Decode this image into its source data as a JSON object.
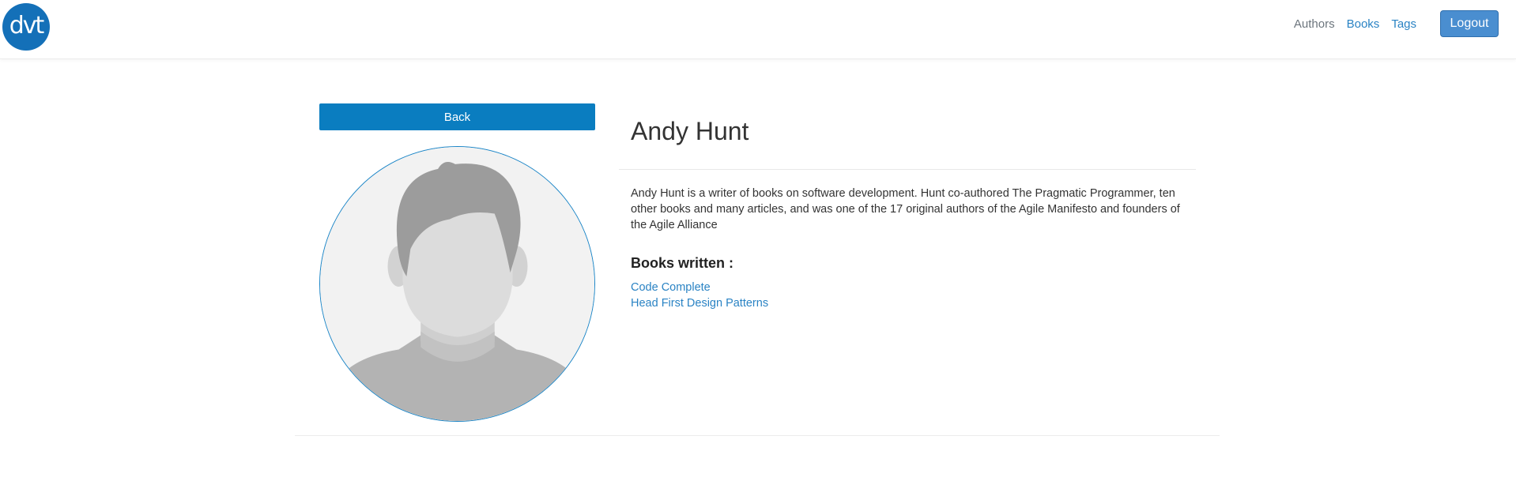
{
  "nav": {
    "logo_text": "dvt",
    "links": [
      "Authors",
      "Books",
      "Tags"
    ],
    "logout_label": "Logout",
    "accent": "#2a83c4"
  },
  "author": {
    "back_label": "Back",
    "name": "Andy Hunt",
    "bio": "Andy Hunt is a writer of books on software development. Hunt co-authored The Pragmatic Programmer, ten other books and many articles, and was one of the 17 original authors of the Agile Manifesto and founders of the Agile Alliance",
    "books_heading": "Books written :",
    "books": [
      "Code Complete",
      "Head First Design Patterns"
    ],
    "avatar_icon": "default-person-avatar"
  }
}
